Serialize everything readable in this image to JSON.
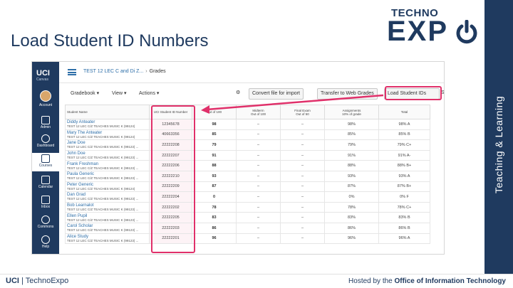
{
  "slide": {
    "title": "Load Student ID Numbers",
    "logo_techno": "TECHNO",
    "logo_expo": "EXP",
    "side_text": "Teaching & Learning",
    "footer_left_bold": "UCI",
    "footer_left_rest": " | TechnoExpo",
    "footer_right_prefix": "Hosted by the ",
    "footer_right_bold": "Office of Information Technology"
  },
  "canvas": {
    "brand": "UCI",
    "brand_sub": "Canvas",
    "nav": [
      {
        "label": "Account",
        "icon": "account-icon"
      },
      {
        "label": "Admin",
        "icon": "admin-icon"
      },
      {
        "label": "Dashboard",
        "icon": "dashboard-icon"
      },
      {
        "label": "Courses",
        "icon": "courses-icon"
      },
      {
        "label": "Calendar",
        "icon": "calendar-icon"
      },
      {
        "label": "Inbox",
        "icon": "inbox-icon"
      },
      {
        "label": "Commons",
        "icon": "commons-icon"
      },
      {
        "label": "Help",
        "icon": "help-icon"
      }
    ],
    "breadcrumb": {
      "course": "TEST 12 LEC C and Di Z...",
      "separator": "›",
      "page": "Grades"
    },
    "toolbar": {
      "gradebook": "Gradebook ▾",
      "view": "View ▾",
      "actions": "Actions ▾",
      "convert": "Convert file for import",
      "transfer": "Transfer to Web Grades",
      "load_ids": "Load Student IDs",
      "search": "Se"
    },
    "columns": [
      {
        "title": "Student Name",
        "sub": ""
      },
      {
        "title": "UCI Student ID Number",
        "sub": ""
      },
      {
        "title": "",
        "sub": "Out of 100"
      },
      {
        "title": "Midterm",
        "sub": "Out of 100"
      },
      {
        "title": "Final Exam",
        "sub": "Out of 50"
      },
      {
        "title": "Assignments",
        "sub": "10% of grade"
      },
      {
        "title": "Total",
        "sub": ""
      }
    ],
    "rows": [
      {
        "name": "Diddy Anteater",
        "section": "TEST 12 LEC C/Z TEACHES MUSIC K (99124)",
        "id": "12345678",
        "score": "98",
        "midterm": "–",
        "final": "–",
        "assign": "98%",
        "total": "98%",
        "letter": "A"
      },
      {
        "name": "Mary The Anteater",
        "section": "TEST 12 LEC C/Z TEACHES MUSIC K (99124)",
        "id": "40663356",
        "score": "85",
        "midterm": "–",
        "final": "–",
        "assign": "85%",
        "total": "85%",
        "letter": "B"
      },
      {
        "name": "Jane Doe",
        "section": "TEST 12 LEC C/Z TEACHES MUSIC K (99123) ...",
        "id": "22222208",
        "score": "79",
        "midterm": "–",
        "final": "–",
        "assign": "79%",
        "total": "79%",
        "letter": "C+"
      },
      {
        "name": "John Doe",
        "section": "TEST 12 LEC C/Z TEACHES MUSIC K (99123) ...",
        "id": "22222207",
        "score": "91",
        "midterm": "–",
        "final": "–",
        "assign": "91%",
        "total": "91%",
        "letter": "A-"
      },
      {
        "name": "Frank Freshman",
        "section": "TEST 12 LEC C/Z TEACHES MUSIC K (99123) ...",
        "id": "22222206",
        "score": "88",
        "midterm": "–",
        "final": "–",
        "assign": "88%",
        "total": "88%",
        "letter": "B+"
      },
      {
        "name": "Paula Generic",
        "section": "TEST 12 LEC C/Z TEACHES MUSIC K (99123) ...",
        "id": "22222210",
        "score": "93",
        "midterm": "–",
        "final": "–",
        "assign": "93%",
        "total": "93%",
        "letter": "A"
      },
      {
        "name": "Peter Generic",
        "section": "TEST 12 LEC C/Z TEACHES MUSIC K (99124)",
        "id": "22222209",
        "score": "87",
        "midterm": "–",
        "final": "–",
        "assign": "87%",
        "total": "87%",
        "letter": "B+"
      },
      {
        "name": "Dan Grad",
        "section": "TEST 12 LEC C/Z TEACHES MUSIC K (99123) ...",
        "id": "22222204",
        "score": "0",
        "midterm": "–",
        "final": "–",
        "assign": "0%",
        "total": "0%",
        "letter": "F"
      },
      {
        "name": "Bob Learnalot",
        "section": "TEST 12 LEC C/Z TEACHES MUSIC K (99123) ...",
        "id": "22222202",
        "score": "78",
        "midterm": "–",
        "final": "–",
        "assign": "78%",
        "total": "78%",
        "letter": "C+"
      },
      {
        "name": "Ellen Pupil",
        "section": "TEST 12 LEC C/Z TEACHES MUSIC K (99123) ...",
        "id": "22222205",
        "score": "83",
        "midterm": "–",
        "final": "–",
        "assign": "83%",
        "total": "83%",
        "letter": "B"
      },
      {
        "name": "Carol Scholar",
        "section": "TEST 12 LEC C/Z TEACHES MUSIC K (99123) ...",
        "id": "22222203",
        "score": "86",
        "midterm": "–",
        "final": "–",
        "assign": "86%",
        "total": "86%",
        "letter": "B"
      },
      {
        "name": "Alice Study",
        "section": "TEST 12 LEC C/Z TEACHES MUSIC K (99123) ...",
        "id": "22222201",
        "score": "96",
        "midterm": "–",
        "final": "–",
        "assign": "96%",
        "total": "96%",
        "letter": "A"
      }
    ],
    "colors": {
      "brand": "#1f3a5f",
      "link": "#2d6ea8",
      "highlight": "#e0306a"
    }
  }
}
